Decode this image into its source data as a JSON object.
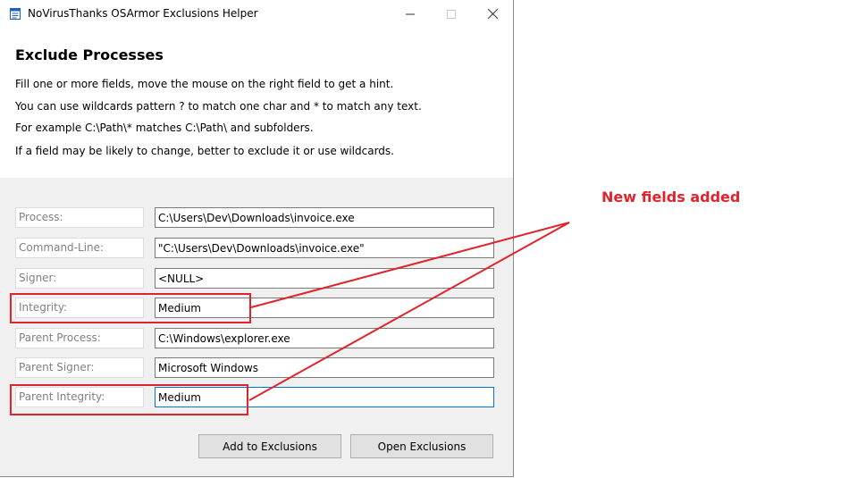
{
  "window": {
    "title": "NoVirusThanks OSArmor Exclusions Helper"
  },
  "header": {
    "heading": "Exclude Processes",
    "lines": [
      "Fill one or more fields, move the mouse on the right field to get a hint.",
      "You can use wildcards pattern ? to match one char and * to match any text.",
      "For example C:\\Path\\* matches C:\\Path\\ and subfolders.",
      "If a field may be likely to change, better to exclude it or use wildcards."
    ]
  },
  "form": {
    "fields": [
      {
        "label": "Process:",
        "value": "C:\\Users\\Dev\\Downloads\\invoice.exe"
      },
      {
        "label": "Command-Line:",
        "value": "\"C:\\Users\\Dev\\Downloads\\invoice.exe\""
      },
      {
        "label": "Signer:",
        "value": "<NULL>"
      },
      {
        "label": "Integrity:",
        "value": "Medium"
      },
      {
        "label": "Parent Process:",
        "value": "C:\\Windows\\explorer.exe"
      },
      {
        "label": "Parent Signer:",
        "value": "Microsoft Windows"
      },
      {
        "label": "Parent Integrity:",
        "value": "Medium"
      }
    ]
  },
  "buttons": {
    "add": "Add to Exclusions",
    "open": "Open Exclusions"
  },
  "annotation": {
    "text": "New fields added",
    "color": "#e0242b"
  }
}
